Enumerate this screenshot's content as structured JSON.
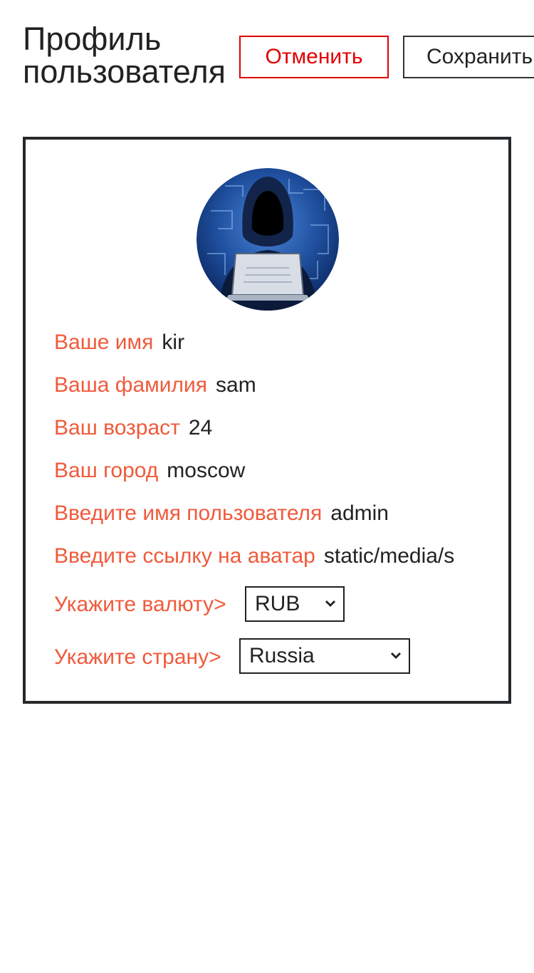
{
  "header": {
    "title_line1": "Профиль",
    "title_line2": "пользователя",
    "cancel_label": "Отменить",
    "save_label": "Сохранить"
  },
  "profile": {
    "first_name_label": "Ваше имя",
    "first_name_value": "kir",
    "last_name_label": "Ваша фамилия",
    "last_name_value": "sam",
    "age_label": "Ваш возраст",
    "age_value": "24",
    "city_label": "Ваш город",
    "city_value": "moscow",
    "username_label": "Введите имя пользователя",
    "username_value": "admin",
    "avatar_link_label": "Введите ссылку на аватар",
    "avatar_link_value": "static/media/s",
    "currency_label": "Укажите валюту>",
    "currency_value": "RUB",
    "country_label": "Укажите страну>",
    "country_value": "Russia"
  },
  "icons": {
    "avatar": "hooded-hacker-avatar",
    "select_arrow": "chevron-down-icon"
  },
  "colors": {
    "label": "#f05a3c",
    "cancel": "#e00000",
    "text": "#222222",
    "border": "#26292c"
  }
}
